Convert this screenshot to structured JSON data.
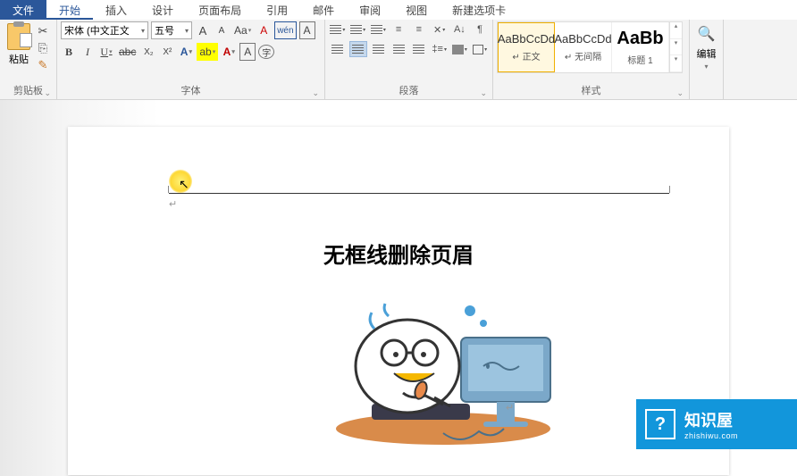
{
  "tabs": {
    "file": "文件",
    "home": "开始",
    "insert": "插入",
    "design": "设计",
    "layout": "页面布局",
    "references": "引用",
    "mailings": "邮件",
    "review": "审阅",
    "view": "视图",
    "newtab": "新建选项卡"
  },
  "clipboard": {
    "paste": "粘贴",
    "label": "剪贴板"
  },
  "font": {
    "name": "宋体 (中文正文",
    "size": "五号",
    "grow": "A",
    "shrink": "A",
    "case": "Aa",
    "clear": "A",
    "ruby": "wén",
    "charborder": "A",
    "bold": "B",
    "italic": "I",
    "underline": "U",
    "strike": "abc",
    "sub": "X₂",
    "sup": "X²",
    "effect": "A",
    "highlight": "ab",
    "color": "A",
    "boxed": "A",
    "circled": "字",
    "label": "字体"
  },
  "para": {
    "label": "段落"
  },
  "styles": {
    "s1_prev": "AaBbCcDd",
    "s1_name": "↵ 正文",
    "s2_prev": "AaBbCcDd",
    "s2_name": "↵ 无间隔",
    "s3_prev": "AaBb",
    "s3_name": "标题 1",
    "label": "样式"
  },
  "editing": {
    "label": "编辑"
  },
  "doc": {
    "title": "无框线删除页眉"
  },
  "watermark": {
    "main": "知识屋",
    "sub": "zhishiwu.com",
    "icon": "?"
  }
}
